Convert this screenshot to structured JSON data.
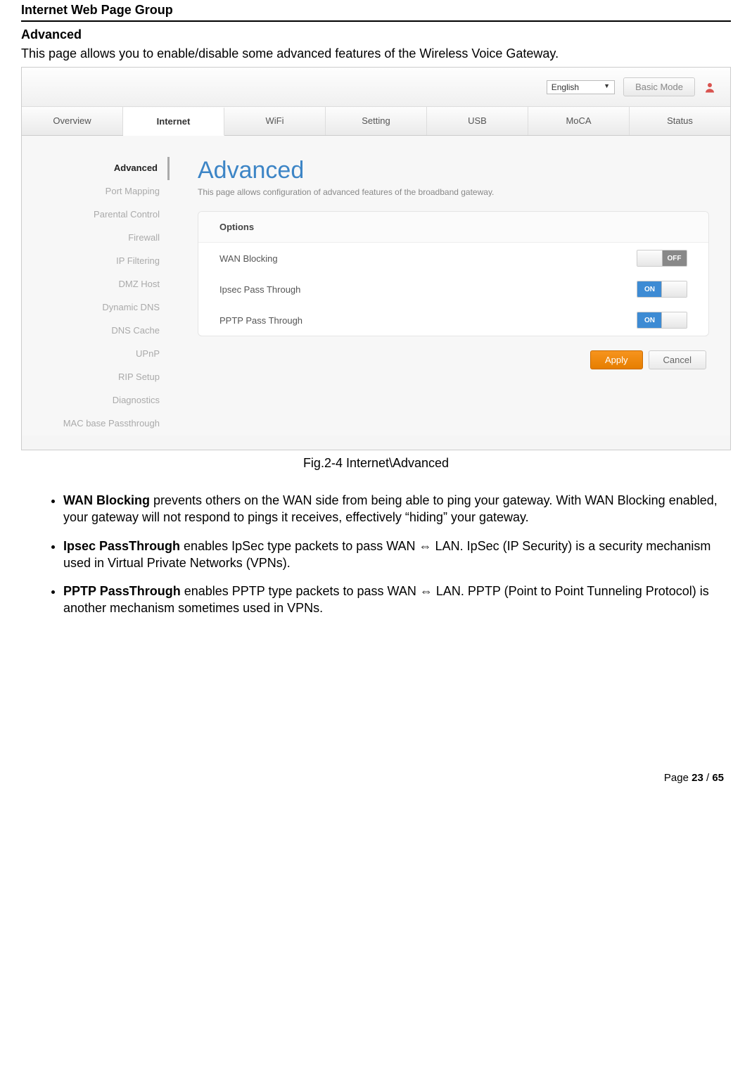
{
  "doc": {
    "header": "Internet Web Page Group",
    "subheader": "Advanced",
    "intro": "This page allows you to enable/disable some advanced features of the Wireless Voice Gateway.",
    "figcaption": "Fig.2-4 Internet\\Advanced",
    "bullets": [
      {
        "term": "WAN Blocking",
        "text": " prevents others on the WAN side from being able to ping your gateway. With WAN Blocking enabled, your gateway will not respond to pings it receives, effectively “hiding” your gateway."
      },
      {
        "term": "Ipsec PassThrough",
        "text": " enables IpSec type packets to pass WAN ⇔ LAN. IpSec (IP Security) is a security mechanism used in Virtual Private Networks (VPNs)."
      },
      {
        "term": "PPTP PassThrough",
        "text": " enables PPTP type packets to pass WAN ⇔ LAN. PPTP (Point to Point Tunneling Protocol) is another mechanism sometimes used in VPNs."
      }
    ],
    "footer_prefix": "Page ",
    "footer_current": "23",
    "footer_sep": " / ",
    "footer_total": "65"
  },
  "topbar": {
    "language": "English",
    "basic_mode": "Basic Mode"
  },
  "mainnav": [
    "Overview",
    "Internet",
    "WiFi",
    "Setting",
    "USB",
    "MoCA",
    "Status"
  ],
  "mainnav_active": 1,
  "sidebar": [
    "Advanced",
    "Port Mapping",
    "Parental Control",
    "Firewall",
    "IP Filtering",
    "DMZ Host",
    "Dynamic DNS",
    "DNS Cache",
    "UPnP",
    "RIP Setup",
    "Diagnostics",
    "MAC base Passthrough"
  ],
  "sidebar_active": 0,
  "content": {
    "title": "Advanced",
    "subtitle": "This page allows configuration of advanced features of the broadband gateway.",
    "panel_header": "Options",
    "options": [
      {
        "label": "WAN Blocking",
        "state": "OFF"
      },
      {
        "label": "Ipsec Pass Through",
        "state": "ON"
      },
      {
        "label": "PPTP Pass Through",
        "state": "ON"
      }
    ],
    "apply": "Apply",
    "cancel": "Cancel"
  }
}
